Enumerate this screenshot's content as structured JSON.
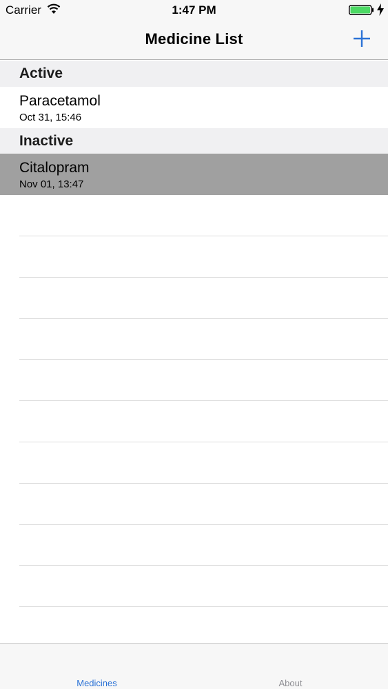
{
  "status_bar": {
    "carrier": "Carrier",
    "time": "1:47 PM",
    "wifi_icon": "wifi-icon",
    "battery_icon": "battery-icon",
    "charging_icon": "bolt-icon"
  },
  "nav": {
    "title": "Medicine List",
    "add_icon": "plus-icon"
  },
  "sections": [
    {
      "header": "Active",
      "rows": [
        {
          "name": "Paracetamol",
          "date": "Oct 31, 15:46",
          "selected": false
        }
      ]
    },
    {
      "header": "Inactive",
      "rows": [
        {
          "name": "Citalopram",
          "date": "Nov 01, 13:47",
          "selected": true
        }
      ]
    }
  ],
  "tabs": [
    {
      "label": "Medicines",
      "active": true
    },
    {
      "label": "About",
      "active": false
    }
  ],
  "colors": {
    "accent": "#2b72d6",
    "selected_row": "#a0a0a0",
    "section_header_bg": "#f0f0f2",
    "battery": "#4cd964"
  }
}
